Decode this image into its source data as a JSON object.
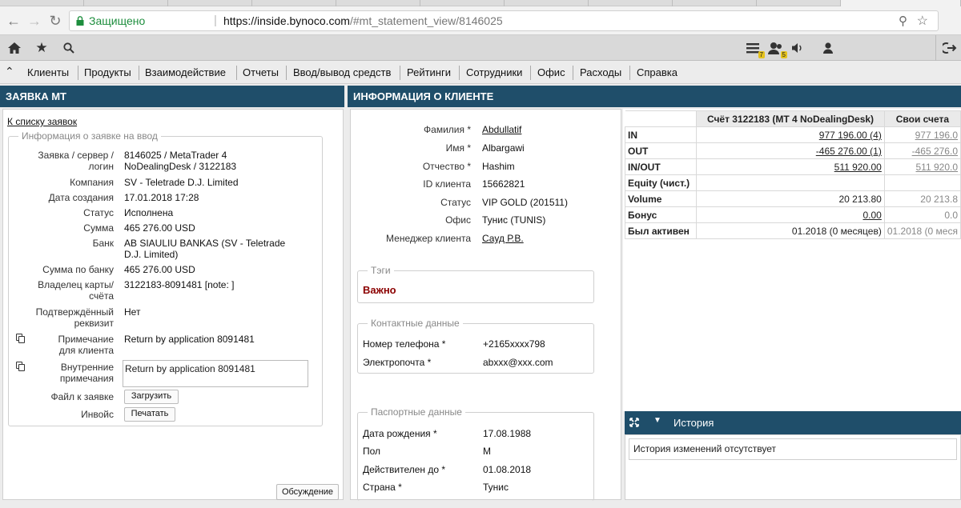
{
  "browser": {
    "secure_label": "Защищено",
    "url_host": "https://inside.bynoco.com",
    "url_path": "/#mt_statement_view/8146025"
  },
  "appbar": {
    "badge_1": "7",
    "badge_2": "5"
  },
  "menu": [
    "Клиенты",
    "Продукты",
    "Взаимодействие",
    "Отчеты",
    "Ввод/вывод средств",
    "Рейтинги",
    "Сотрудники",
    "Офис",
    "Расходы",
    "Справка"
  ],
  "left": {
    "header": "ЗАЯВКА МТ",
    "back_link": "К списку заявок",
    "legend": "Информация о заявке на ввод",
    "fields": {
      "request_label_1": "Заявка / сервер /",
      "request_label_2": "логин",
      "request_value_1": "8146025 / MetaTrader 4",
      "request_value_2": "NoDealingDesk / 3122183",
      "company_label": "Компания",
      "company_value": "SV - Teletrade D.J. Limited",
      "created_label": "Дата создания",
      "created_value": "17.01.2018 17:28",
      "status_label": "Статус",
      "status_value": "Исполнена",
      "sum_label": "Сумма",
      "sum_value": "465 276.00 USD",
      "bank_label": "Банк",
      "bank_value_1": "AB SIAULIU BANKAS (SV - Teletrade",
      "bank_value_2": "D.J. Limited)",
      "bank_sum_label": "Сумма по банку",
      "bank_sum_value": "465 276.00 USD",
      "owner_label_1": "Владелец карты/",
      "owner_label_2": "счёта",
      "owner_value": "3122183-8091481 [note: ]",
      "confirmed_label_1": "Подтверждённый",
      "confirmed_label_2": "реквизит",
      "confirmed_value": "Нет",
      "client_note_label_1": "Примечание",
      "client_note_label_2": "для клиента",
      "client_note_value": "Return by application 8091481",
      "internal_note_label_1": "Внутренние",
      "internal_note_label_2": "примечания",
      "internal_note_value": "Return by application 8091481",
      "file_label": "Файл к заявке",
      "upload_button": "Загрузить",
      "invoice_label": "Инвойс",
      "print_button": "Печатать"
    },
    "discussion_button": "Обсуждение"
  },
  "client": {
    "header": "ИНФОРМАЦИЯ О КЛИЕНТЕ",
    "surname_label": "Фамилия *",
    "surname_value": "Abdullatif",
    "name_label": "Имя *",
    "name_value": "Albargawi",
    "patronymic_label": "Отчество *",
    "patronymic_value": "Hashim",
    "id_label": "ID клиента",
    "id_value": "15662821",
    "status_label": "Статус",
    "status_value": "VIP GOLD (201511)",
    "office_label": "Офис",
    "office_value": "Тунис (TUNIS)",
    "manager_label": "Менеджер клиента",
    "manager_value": "Сауд Р.В.",
    "tags_legend": "Тэги",
    "tag_important": "Важно",
    "contacts_legend": "Контактные данные",
    "phone_label": "Номер телефона *",
    "phone_value": "+2165xxxx798",
    "email_label": "Электропочта *",
    "email_value": "abxxx@xxx.com",
    "passport_legend": "Паспортные данные",
    "birth_label": "Дата рождения *",
    "birth_value": "17.08.1988",
    "gender_label": "Пол",
    "gender_value": "М",
    "valid_label": "Действителен до *",
    "valid_value": "01.08.2018",
    "country_label": "Страна *",
    "country_value": "Тунис"
  },
  "account_table": {
    "col_account": "Счёт 3122183 (MT 4 NoDealingDesk)",
    "col_own": "Свои счета",
    "rows": [
      {
        "label": "IN",
        "account": "977 196.00 (4)",
        "own": "977 196.0"
      },
      {
        "label": "OUT",
        "account": "-465 276.00 (1)",
        "own": "-465 276.0"
      },
      {
        "label": "IN/OUT",
        "account": "511 920.00",
        "own": "511 920.0"
      },
      {
        "label": "Equity (чист.)",
        "account": "",
        "own": ""
      },
      {
        "label": "Volume",
        "account": "20 213.80",
        "own": "20 213.8"
      },
      {
        "label": "Бонус",
        "account": "0.00",
        "own": "0.0"
      },
      {
        "label": "Был активен",
        "account": "01.2018 (0 месяцев)",
        "own": "01.2018 (0 меся"
      }
    ]
  },
  "history": {
    "title": "История",
    "empty_message": "История изменений отсутствует"
  },
  "colors": {
    "header_bg": "#1f4e6a",
    "secure_green": "#1e8e3e",
    "important_red": "#8b0000",
    "badge_yellow": "#e5c21c"
  }
}
